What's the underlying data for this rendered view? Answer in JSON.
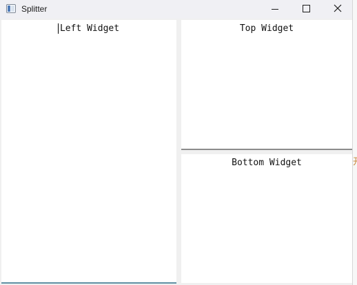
{
  "window": {
    "title": "Splitter",
    "icon": "window-app-icon",
    "controls": {
      "minimize": "minimize-icon",
      "maximize": "maximize-icon",
      "close": "close-icon"
    }
  },
  "panes": {
    "left": {
      "label": "Left Widget"
    },
    "top": {
      "label": "Top Widget"
    },
    "bottom": {
      "label": "Bottom Widget"
    }
  },
  "background": {
    "partial_glyph": "开"
  },
  "colors": {
    "titlebar": "#f0f0f4",
    "pane_background": "#ffffff",
    "splitter_background": "#f0f0f0",
    "horizontal_handle_line": "#8c8c8c",
    "left_pane_bottom_accent": "#5f8fa3"
  }
}
